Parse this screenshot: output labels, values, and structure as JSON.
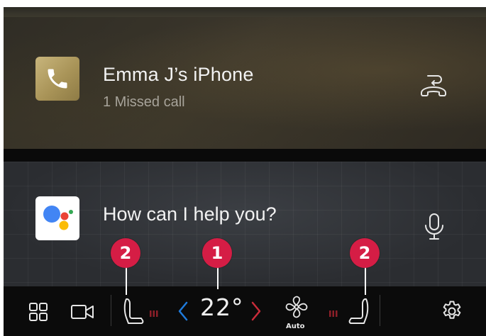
{
  "notification": {
    "caller_name": "Emma J’s iPhone",
    "status": "1 Missed call",
    "app_icon": "phone-icon",
    "action_icon": "call-back-icon"
  },
  "assistant": {
    "prompt": "How can I help you?",
    "app_icon": "google-assistant-icon",
    "action_icon": "microphone-icon"
  },
  "climate_bar": {
    "icons": [
      "app-grid-icon",
      "camera-icon",
      "driver-seat-icon",
      "seat-heat-level-icon",
      "temp-decrease-icon",
      "temp-increase-icon",
      "fan-icon",
      "passenger-seat-icon",
      "settings-icon"
    ],
    "temperature": "22°",
    "fan_mode": "Auto"
  },
  "callouts": {
    "temperature_marker": "1",
    "driver_seat_marker": "2",
    "passenger_seat_marker": "2"
  },
  "colors": {
    "callout": "#d51d45",
    "temp_arrow": "#1f7bdc",
    "temp_arrow_right": "#c92c3a",
    "phone_icon_bg": "#b3a066",
    "seat_heat": "#8c1f28"
  }
}
